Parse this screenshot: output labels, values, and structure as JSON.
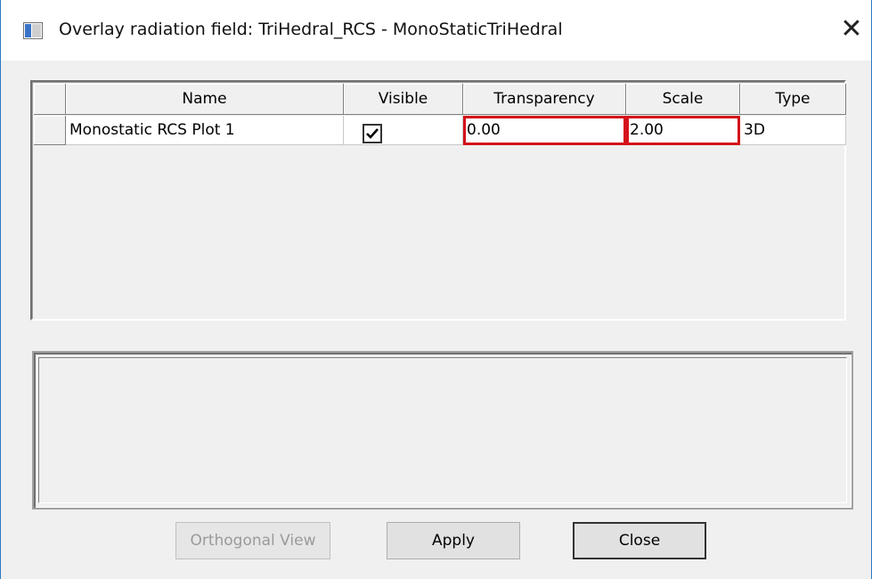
{
  "window": {
    "title": "Overlay radiation field: TriHedral_RCS - MonoStaticTriHedral",
    "close_glyph": "✕",
    "icon": "app-window-icon"
  },
  "table": {
    "columns": [
      "Name",
      "Visible",
      "Transparency",
      "Scale",
      "Type"
    ],
    "rows": [
      {
        "name": "Monostatic RCS Plot 1",
        "visible": true,
        "transparency": "0.00",
        "scale": "2.00",
        "type": "3D"
      }
    ],
    "highlight_color": "#d4131b"
  },
  "buttons": {
    "orthogonal_view": "Orthogonal View",
    "apply": "Apply",
    "close": "Close"
  }
}
